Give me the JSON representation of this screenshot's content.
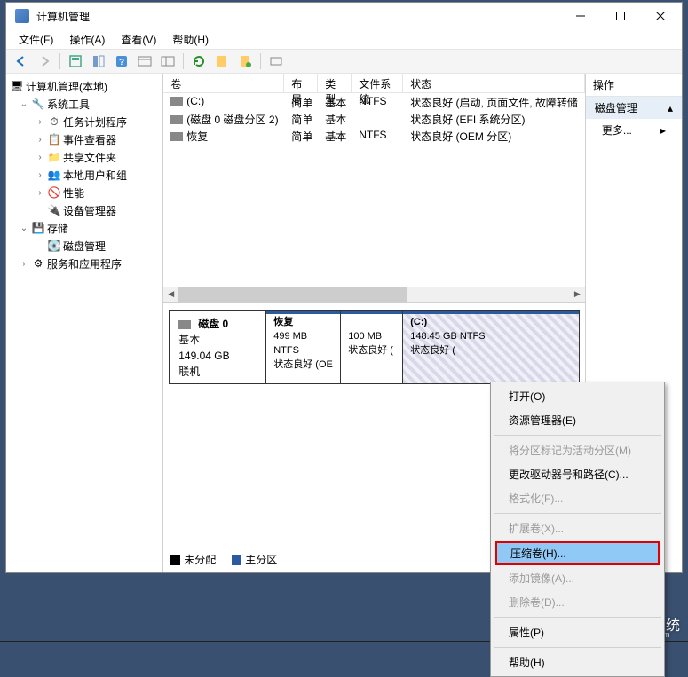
{
  "window": {
    "title": "计算机管理"
  },
  "menu": {
    "file": "文件(F)",
    "action": "操作(A)",
    "view": "查看(V)",
    "help": "帮助(H)"
  },
  "tree": {
    "root": "计算机管理(本地)",
    "system_tools": "系统工具",
    "scheduler": "任务计划程序",
    "event_viewer": "事件查看器",
    "shared": "共享文件夹",
    "users": "本地用户和组",
    "perf": "性能",
    "devmgr": "设备管理器",
    "storage": "存储",
    "diskmgmt": "磁盘管理",
    "services": "服务和应用程序"
  },
  "columns": {
    "volume": "卷",
    "layout": "布局",
    "type": "类型",
    "fs": "文件系统",
    "status": "状态"
  },
  "volumes": [
    {
      "name": "(C:)",
      "layout": "简单",
      "type": "基本",
      "fs": "NTFS",
      "status": "状态良好 (启动, 页面文件, 故障转储"
    },
    {
      "name": "(磁盘 0 磁盘分区 2)",
      "layout": "简单",
      "type": "基本",
      "fs": "",
      "status": "状态良好 (EFI 系统分区)"
    },
    {
      "name": "恢复",
      "layout": "简单",
      "type": "基本",
      "fs": "NTFS",
      "status": "状态良好 (OEM 分区)"
    }
  ],
  "disk": {
    "label": "磁盘 0",
    "type": "基本",
    "size": "149.04 GB",
    "status": "联机",
    "parts": [
      {
        "name": "恢复",
        "size": "499 MB NTFS",
        "status": "状态良好 (OE"
      },
      {
        "name": "",
        "size": "100 MB",
        "status": "状态良好 ("
      },
      {
        "name": "(C:)",
        "size": "148.45 GB NTFS",
        "status": "状态良好 ("
      }
    ]
  },
  "legend": {
    "unalloc": "未分配",
    "primary": "主分区"
  },
  "actions": {
    "header": "操作",
    "diskmgmt": "磁盘管理",
    "more": "更多..."
  },
  "context": {
    "open": "打开(O)",
    "explorer": "资源管理器(E)",
    "mark_active": "将分区标记为活动分区(M)",
    "change_letter": "更改驱动器号和路径(C)...",
    "format": "格式化(F)...",
    "extend": "扩展卷(X)...",
    "shrink": "压缩卷(H)...",
    "mirror": "添加镜像(A)...",
    "delete": "删除卷(D)...",
    "properties": "属性(P)",
    "help": "帮助(H)"
  },
  "watermark": {
    "text": "白云一键重装系统",
    "url": "www.baiyunxitong.com"
  }
}
